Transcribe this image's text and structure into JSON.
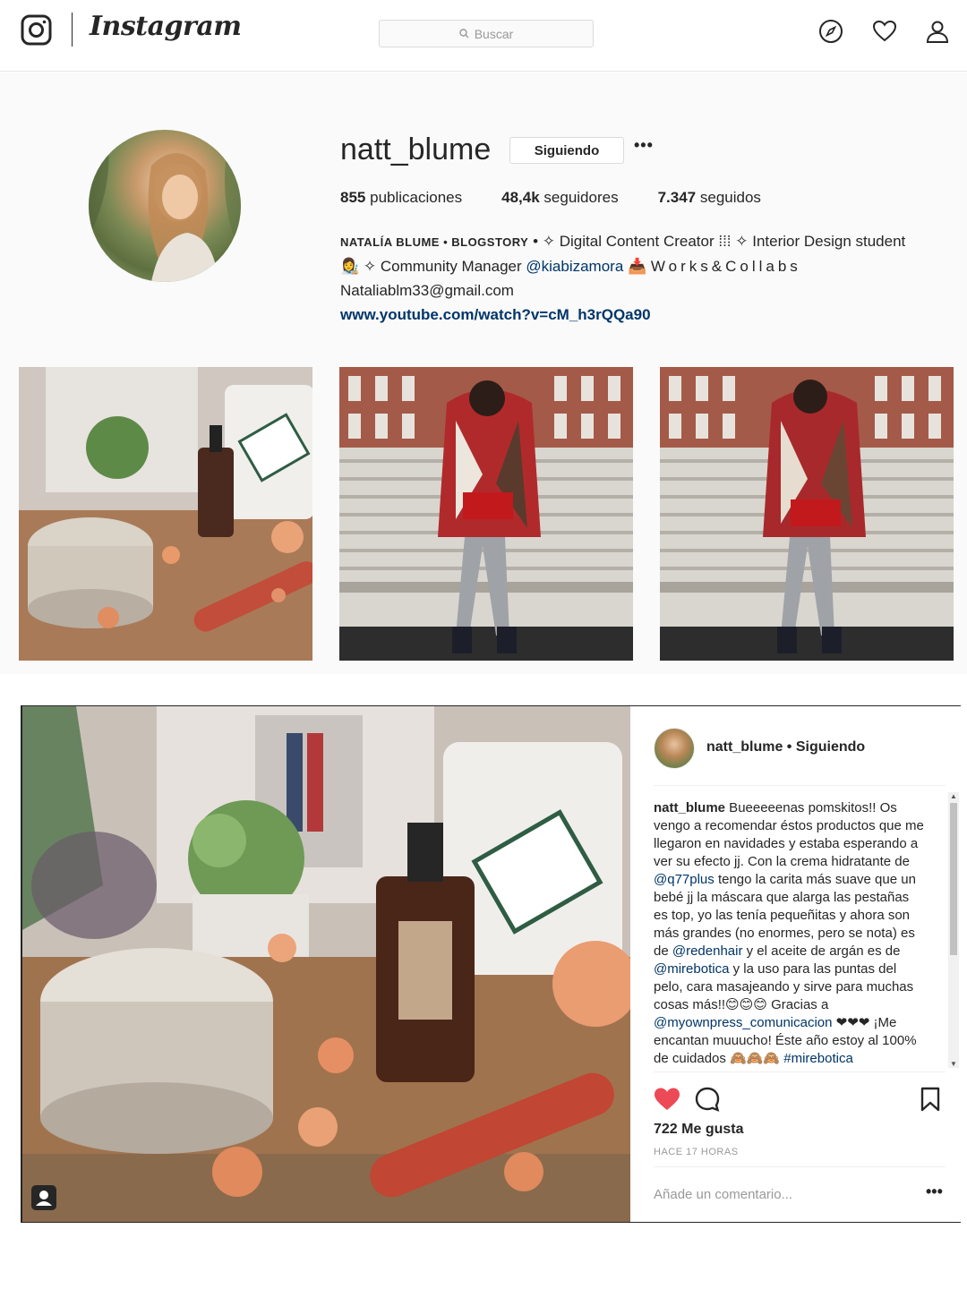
{
  "header": {
    "wordmark": "Instagram",
    "search_placeholder": "Buscar",
    "icons": [
      "instagram-camera-icon",
      "search-icon",
      "explore-compass-icon",
      "heart-icon",
      "profile-icon"
    ]
  },
  "profile": {
    "username": "natt_blume",
    "follow_label": "Siguiendo",
    "more_label": "•••",
    "stats": {
      "posts_count": "855",
      "posts_label": "publicaciones",
      "followers_count": "48,4k",
      "followers_label": "seguidores",
      "following_count": "7.347",
      "following_label": "seguidos"
    },
    "bio": {
      "name": "NATALÍA BLUME • BLOGSTORY",
      "line1_rest": " • ✧ Digital Content Creator ⁞⁞⁞ ✧ Interior Design student",
      "line2_prefix": "👩‍🎨 ✧ Community Manager ",
      "line2_mention": "@kiabizamora",
      "line2_suffix": " 📥 ",
      "line2_spaced": "Works&Collabs",
      "email": "Nataliablm33@gmail.com",
      "link": "www.youtube.com/watch?v=cM_h3rQQa90"
    }
  },
  "post": {
    "username": "natt_blume",
    "following_label": "• Siguiendo",
    "caption_user": "natt_blume",
    "caption_part1": " Bueeeeenas pomskitos!! Os vengo a recomendar éstos productos que me llegaron en navidades y estaba esperando a ver su efecto jj. Con la crema hidratante de ",
    "mention1": "@q77plus",
    "caption_part2": " tengo la carita más suave que un bebé jj la máscara que alarga las pestañas es top, yo las tenía pequeñitas y ahora son más grandes (no enormes, pero se nota) es de ",
    "mention2": "@redenhair",
    "caption_part3": " y el aceite de argán es de ",
    "mention3": "@mirebotica",
    "caption_part4": " y la uso para las puntas del pelo, cara masajeando y sirve para muchas cosas más!!😊😊😊 Gracias a ",
    "mention4": "@myownpress_comunicacion",
    "caption_part5": " ❤❤❤ ¡Me encantan muuucho! Éste año estoy al 100% de cuidados 🙈🙈🙈 ",
    "hashtag": "#mirebotica",
    "likes": "722 Me gusta",
    "time": "HACE 17 HORAS",
    "comment_placeholder": "Añade un comentario...",
    "more_label": "•••",
    "liked_color": "#ed4956"
  }
}
